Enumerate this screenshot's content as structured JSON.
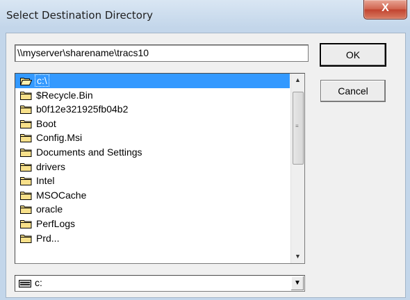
{
  "window": {
    "title": "Select Destination Directory",
    "close_label": "X"
  },
  "path_input": {
    "value": "\\\\myserver\\sharename\\tracs10"
  },
  "buttons": {
    "ok_label": "OK",
    "cancel_label": "Cancel"
  },
  "folders": [
    {
      "label": "c:\\",
      "selected": true,
      "icon": "open-folder-icon"
    },
    {
      "label": "$Recycle.Bin",
      "icon": "folder-icon"
    },
    {
      "label": "b0f12e321925fb04b2",
      "icon": "folder-icon"
    },
    {
      "label": "Boot",
      "icon": "folder-icon"
    },
    {
      "label": "Config.Msi",
      "icon": "folder-icon"
    },
    {
      "label": "Documents and Settings",
      "icon": "folder-icon"
    },
    {
      "label": "drivers",
      "icon": "folder-icon"
    },
    {
      "label": "Intel",
      "icon": "folder-icon"
    },
    {
      "label": "MSOCache",
      "icon": "folder-icon"
    },
    {
      "label": "oracle",
      "icon": "folder-icon"
    },
    {
      "label": "PerfLogs",
      "icon": "folder-icon"
    },
    {
      "label": "Prd...",
      "icon": "folder-icon"
    }
  ],
  "drive_combo": {
    "value": "c:",
    "icon": "drive-icon"
  },
  "colors": {
    "selection": "#3399ff",
    "close_button": "#c1432f",
    "folder_fill": "#f7e08a"
  }
}
